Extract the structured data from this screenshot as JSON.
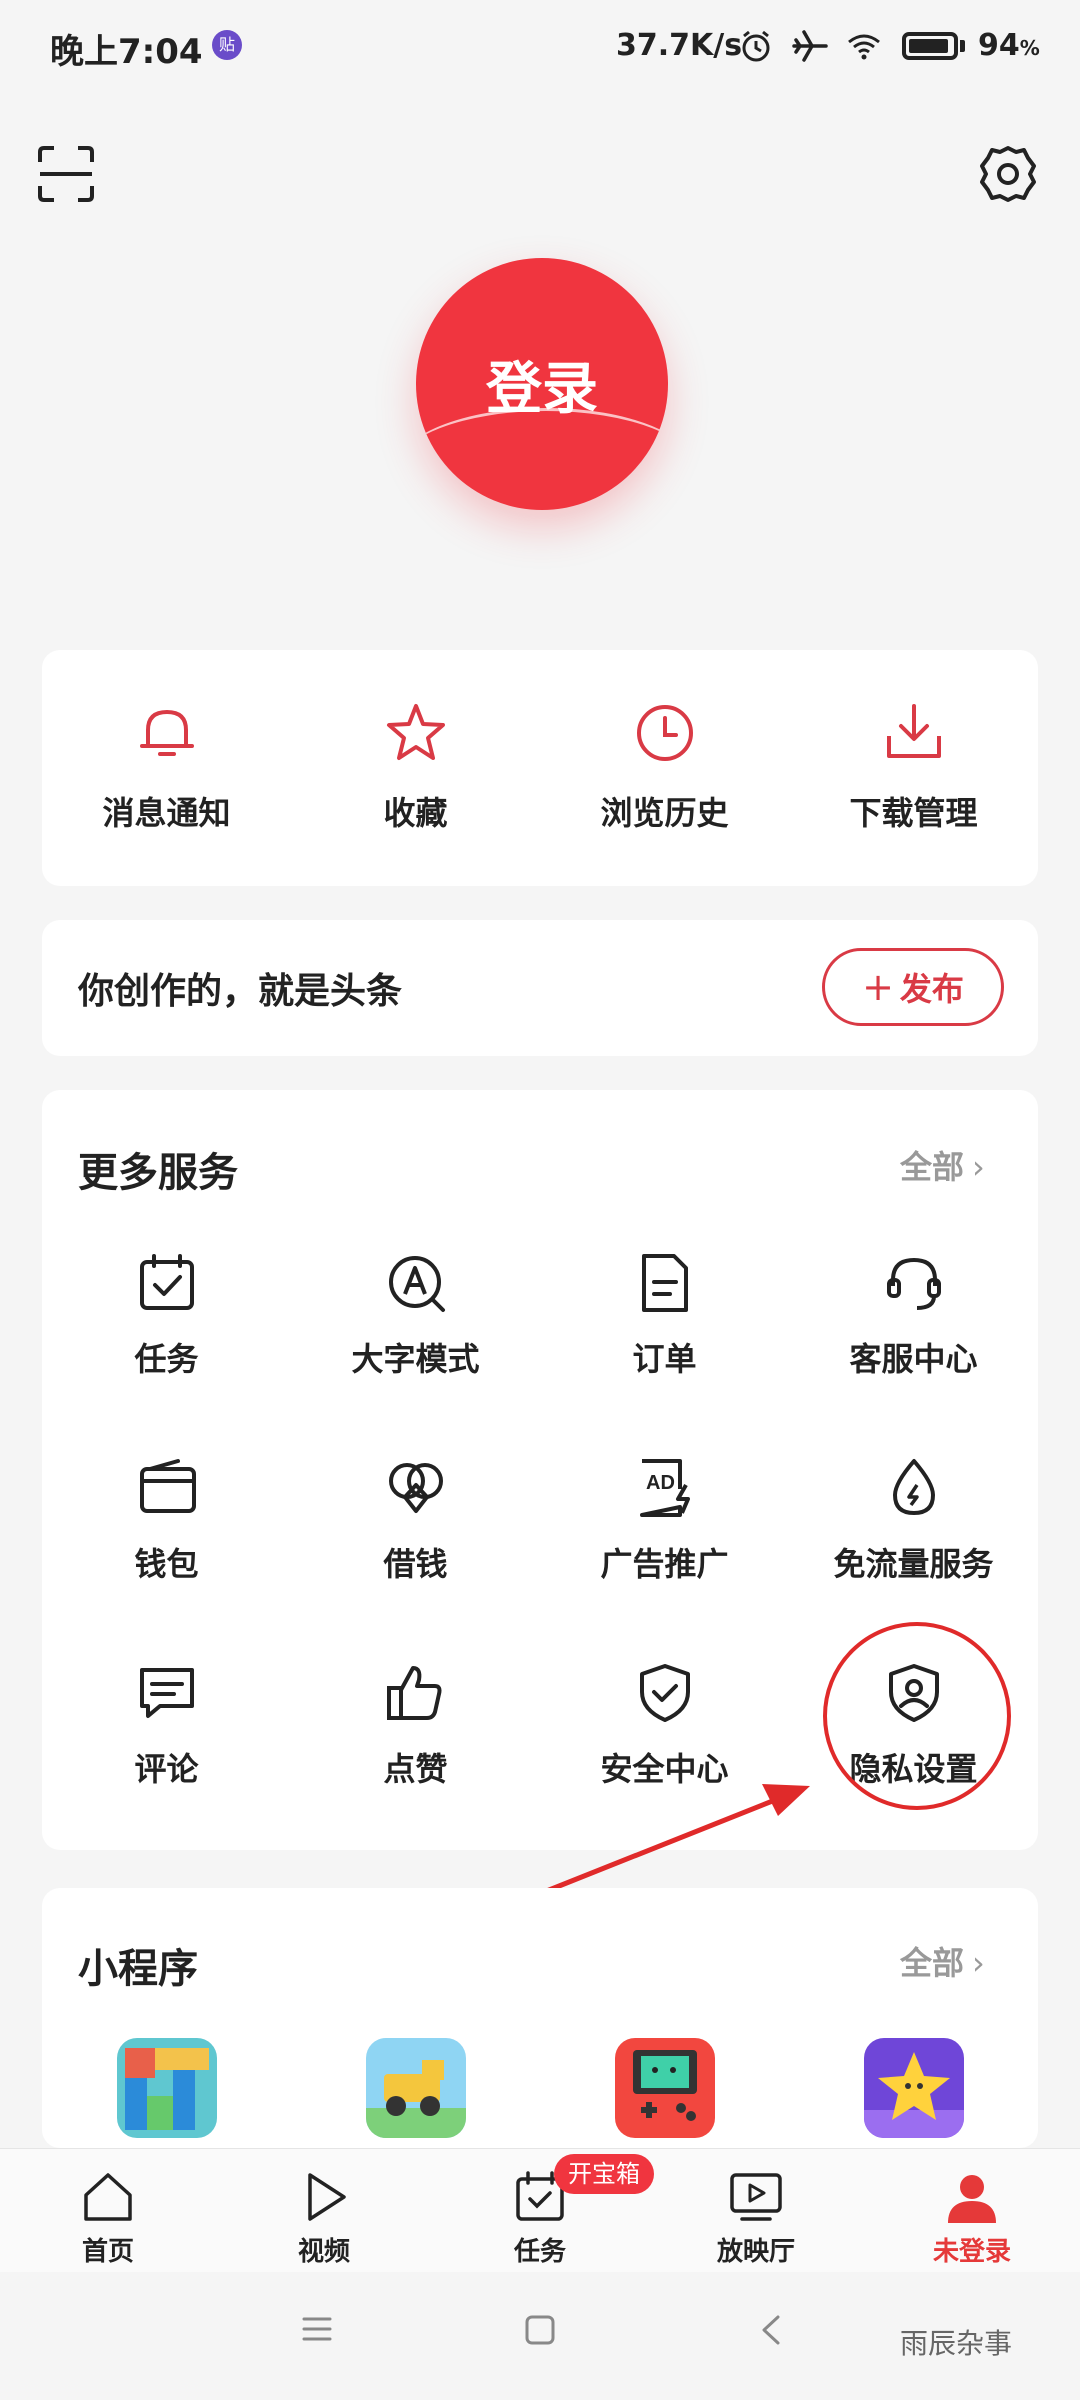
{
  "status_bar": {
    "time": "晚上7:04",
    "notification_badge": "贴",
    "speed": "37.7K/s",
    "battery_level": 94,
    "battery_value": "94",
    "battery_unit": "%",
    "icons": [
      "alarm-icon",
      "airplane-icon",
      "wifi-icon",
      "battery-icon"
    ]
  },
  "header": {
    "scan_icon": "scan-icon",
    "settings_icon": "gear-icon",
    "login_label": "登录"
  },
  "quick_actions": [
    {
      "label": "消息通知",
      "icon": "bell-icon"
    },
    {
      "label": "收藏",
      "icon": "star-icon"
    },
    {
      "label": "浏览历史",
      "icon": "clock-icon"
    },
    {
      "label": "下载管理",
      "icon": "download-icon"
    }
  ],
  "publish": {
    "slogan": "你创作的，就是头条",
    "button_plus": "+",
    "button_label": "发布"
  },
  "services": {
    "title": "更多服务",
    "all_label": "全部",
    "items": [
      {
        "label": "任务",
        "icon": "task-icon"
      },
      {
        "label": "大字模式",
        "icon": "large-font-icon"
      },
      {
        "label": "订单",
        "icon": "order-icon"
      },
      {
        "label": "客服中心",
        "icon": "headset-icon"
      },
      {
        "label": "钱包",
        "icon": "wallet-icon"
      },
      {
        "label": "借钱",
        "icon": "loan-icon"
      },
      {
        "label": "广告推广",
        "icon": "ad-icon"
      },
      {
        "label": "免流量服务",
        "icon": "data-free-icon"
      },
      {
        "label": "评论",
        "icon": "comment-icon"
      },
      {
        "label": "点赞",
        "icon": "thumbs-up-icon"
      },
      {
        "label": "安全中心",
        "icon": "shield-check-icon"
      },
      {
        "label": "隐私设置",
        "icon": "privacy-shield-icon"
      }
    ]
  },
  "mini_programs": {
    "title": "小程序",
    "all_label": "全部",
    "items": [
      "tetris-game-icon",
      "truck-game-icon",
      "gameboy-game-icon",
      "star-game-icon"
    ]
  },
  "bottom_nav": [
    {
      "label": "首页",
      "icon": "home-icon",
      "active": false
    },
    {
      "label": "视频",
      "icon": "play-icon",
      "active": false
    },
    {
      "label": "任务",
      "icon": "task-nav-icon",
      "active": false
    },
    {
      "label": "放映厅",
      "icon": "cinema-icon",
      "active": false
    },
    {
      "label": "未登录",
      "icon": "user-icon",
      "active": true
    }
  ],
  "task_badge": "开宝箱",
  "watermark": "雨辰杂事",
  "colors": {
    "accent": "#f0353f",
    "highlight": "#e02a2a",
    "background": "#f5f5f5",
    "card": "#ffffff"
  }
}
